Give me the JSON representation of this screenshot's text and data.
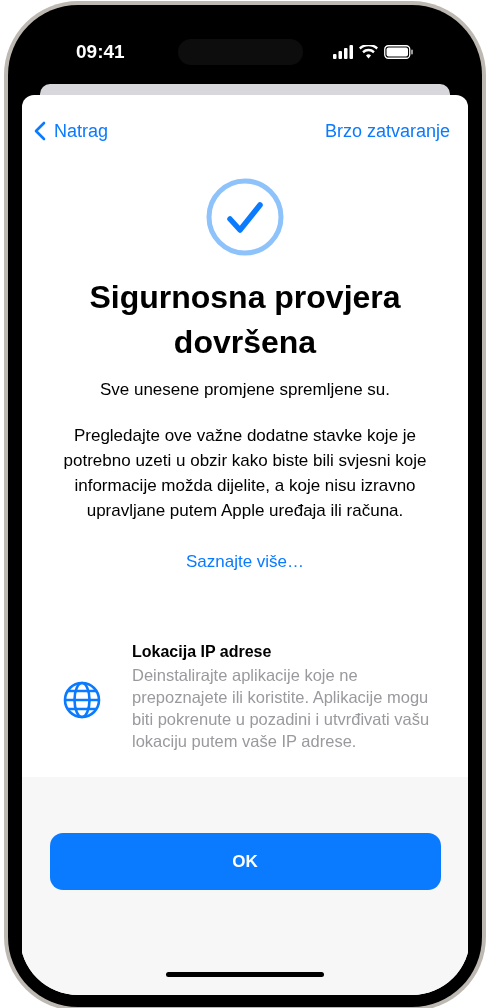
{
  "status_bar": {
    "time": "09:41"
  },
  "nav": {
    "back": "Natrag",
    "action": "Brzo zatvaranje"
  },
  "title": "Sigurnosna provjera dovršena",
  "subtitle": "Sve unesene promjene spremljene su.",
  "body": "Pregledajte ove važne dodatne stavke koje je potrebno uzeti u obzir kako biste bili svjesni koje informacije možda dijelite, a koje nisu izravno upravljane putem Apple uređaja ili računa.",
  "link": "Saznajte više…",
  "items": [
    {
      "title": "Lokacija IP adrese",
      "description": "Deinstalirajte aplikacije koje ne prepoznajete ili koristite. Aplikacije mogu biti pokrenute u pozadini i utvrđivati vašu lokaciju putem vaše IP adrese."
    }
  ],
  "button": "OK"
}
